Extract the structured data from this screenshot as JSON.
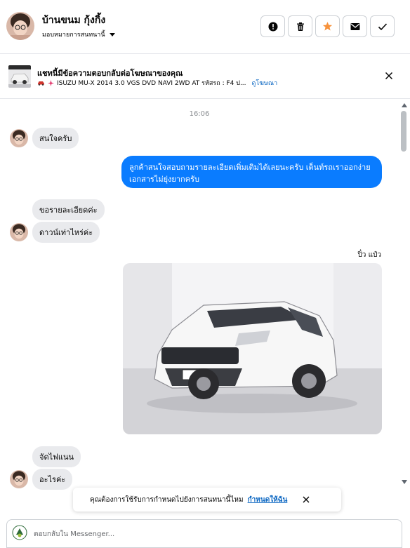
{
  "header": {
    "contact_name": "บ้านขนม กุ้งกิ้ง",
    "assign_label": "มอบหมายการสนทนานี้",
    "action_icons": [
      "alert-icon",
      "trash-icon",
      "star-icon",
      "mail-icon",
      "check-icon"
    ],
    "star_color": "#f7923b"
  },
  "ad": {
    "title": "แชทนี้มีข้อความตอบกลับต่อโฆษณาของคุณ",
    "description": "ISUZU MU-X 2014 3.0 VGS DVD NAVI 2WD AT รหัสรถ : F4 ป...",
    "view_ad_link": "ดูโฆษณา"
  },
  "chat": {
    "timestamp": "16:06",
    "messages": [
      {
        "direction": "in",
        "text": "สนใจครับ"
      },
      {
        "direction": "out",
        "text": "ลูกค้าสนใจสอบถามรายละเอียดเพิ่มเติมได้เลยนะครับ เต็นท์รถเราออกง่ายเอกสารไม่ยุ่งยากครับ"
      },
      {
        "direction": "in",
        "text": "ขอรายละเอียดค่ะ"
      },
      {
        "direction": "in",
        "text": "ดาวน์เท่าไหร่ค่ะ"
      },
      {
        "direction": "out",
        "sender": "ปิ๋ว แป๋ว",
        "attachment": "car-photo"
      },
      {
        "direction": "in",
        "text": "จัดไฟแนน"
      },
      {
        "direction": "in",
        "text": "อะไรค่ะ"
      }
    ],
    "outgoing_color": "#0a7cff",
    "incoming_color": "#e9eaed"
  },
  "toast": {
    "text": "คุณต้องการใช้รับการกำหนดไปยังการสนทนานี้ไหม",
    "link": "กำหนดให้ฉัน"
  },
  "composer": {
    "placeholder": "ตอบกลับใน Messenger..."
  }
}
